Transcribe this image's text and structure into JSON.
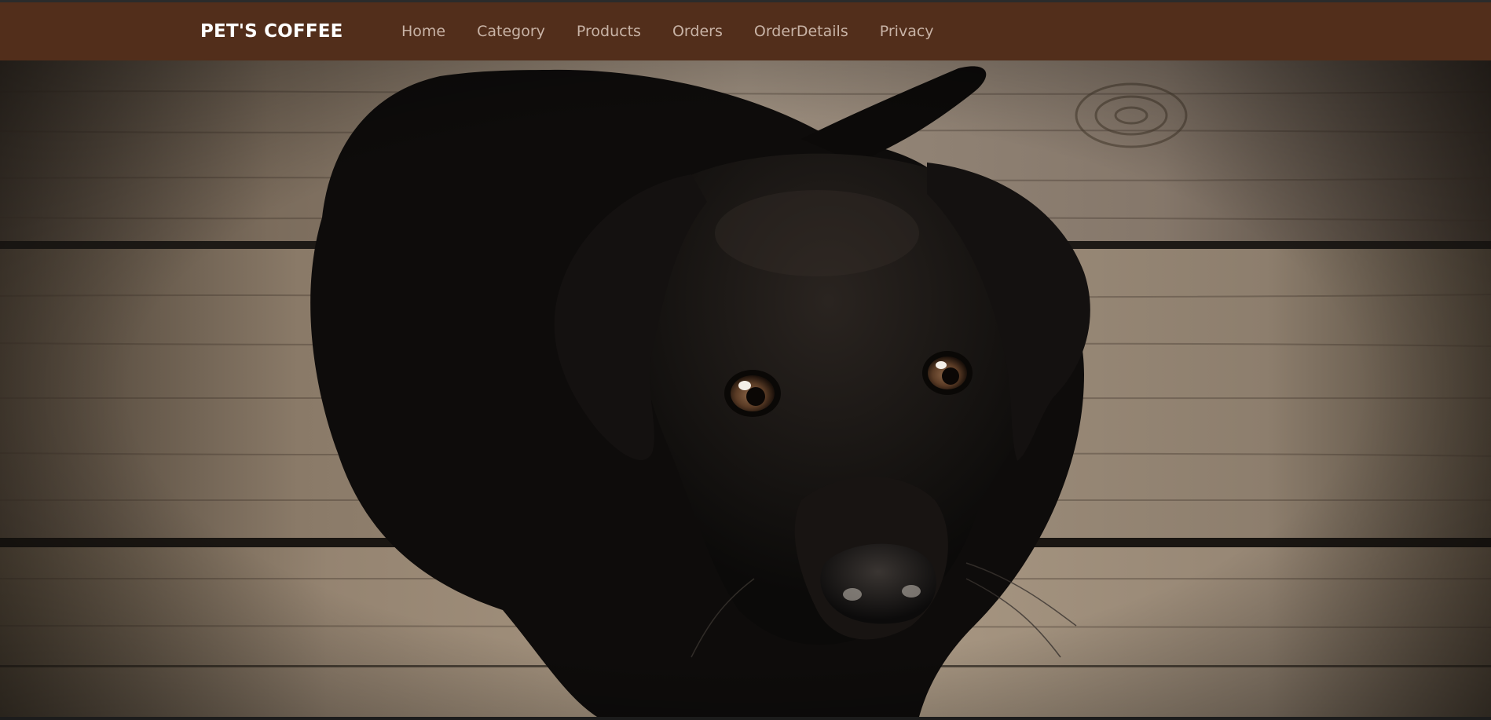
{
  "navbar": {
    "brand": "PET'S COFFEE",
    "links": [
      "Home",
      "Category",
      "Products",
      "Orders",
      "OrderDetails",
      "Privacy"
    ]
  },
  "hero": {
    "image_subject": "black-puppy-on-wooden-floor"
  },
  "colors": {
    "navbar_bg": "#522e1b",
    "brand_text": "#ffffff",
    "nav_link_text": "#c8b3a6"
  }
}
